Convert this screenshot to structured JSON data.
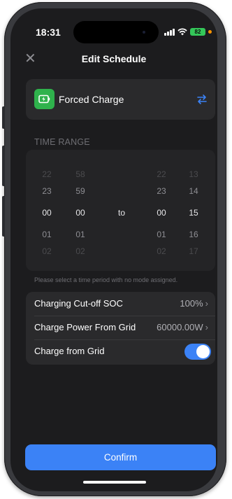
{
  "status_bar": {
    "time": "18:31",
    "battery": "82"
  },
  "header": {
    "title": "Edit Schedule",
    "close_icon": "close-icon"
  },
  "mode": {
    "label": "Forced Charge",
    "icon": "battery-charge-icon",
    "swap_icon": "swap-arrows-icon"
  },
  "time_range": {
    "label": "TIME RANGE",
    "separator": "to",
    "start_hour": {
      "far_prev": "22",
      "prev": "23",
      "selected": "00",
      "next": "01",
      "far_next": "02"
    },
    "start_minute": {
      "far_prev": "58",
      "prev": "59",
      "selected": "00",
      "next": "01",
      "far_next": "02"
    },
    "end_hour": {
      "far_prev": "22",
      "prev": "23",
      "selected": "00",
      "next": "01",
      "far_next": "02"
    },
    "end_minute": {
      "far_prev": "13",
      "prev": "14",
      "selected": "15",
      "next": "16",
      "far_next": "17"
    },
    "hint": "Please select a time period with no mode assigned."
  },
  "settings": {
    "cutoff_soc": {
      "label": "Charging Cut-off SOC",
      "value": "100%"
    },
    "grid_power": {
      "label": "Charge Power From Grid",
      "value": "60000.00W"
    },
    "charge_from_grid": {
      "label": "Charge from Grid",
      "enabled": true
    }
  },
  "footer": {
    "confirm_label": "Confirm"
  },
  "colors": {
    "accent": "#3b82f6",
    "mode_icon_bg": "#2fb24c",
    "battery": "#34c759",
    "background": "#1c1c1e",
    "card": "#2a2a2c"
  }
}
